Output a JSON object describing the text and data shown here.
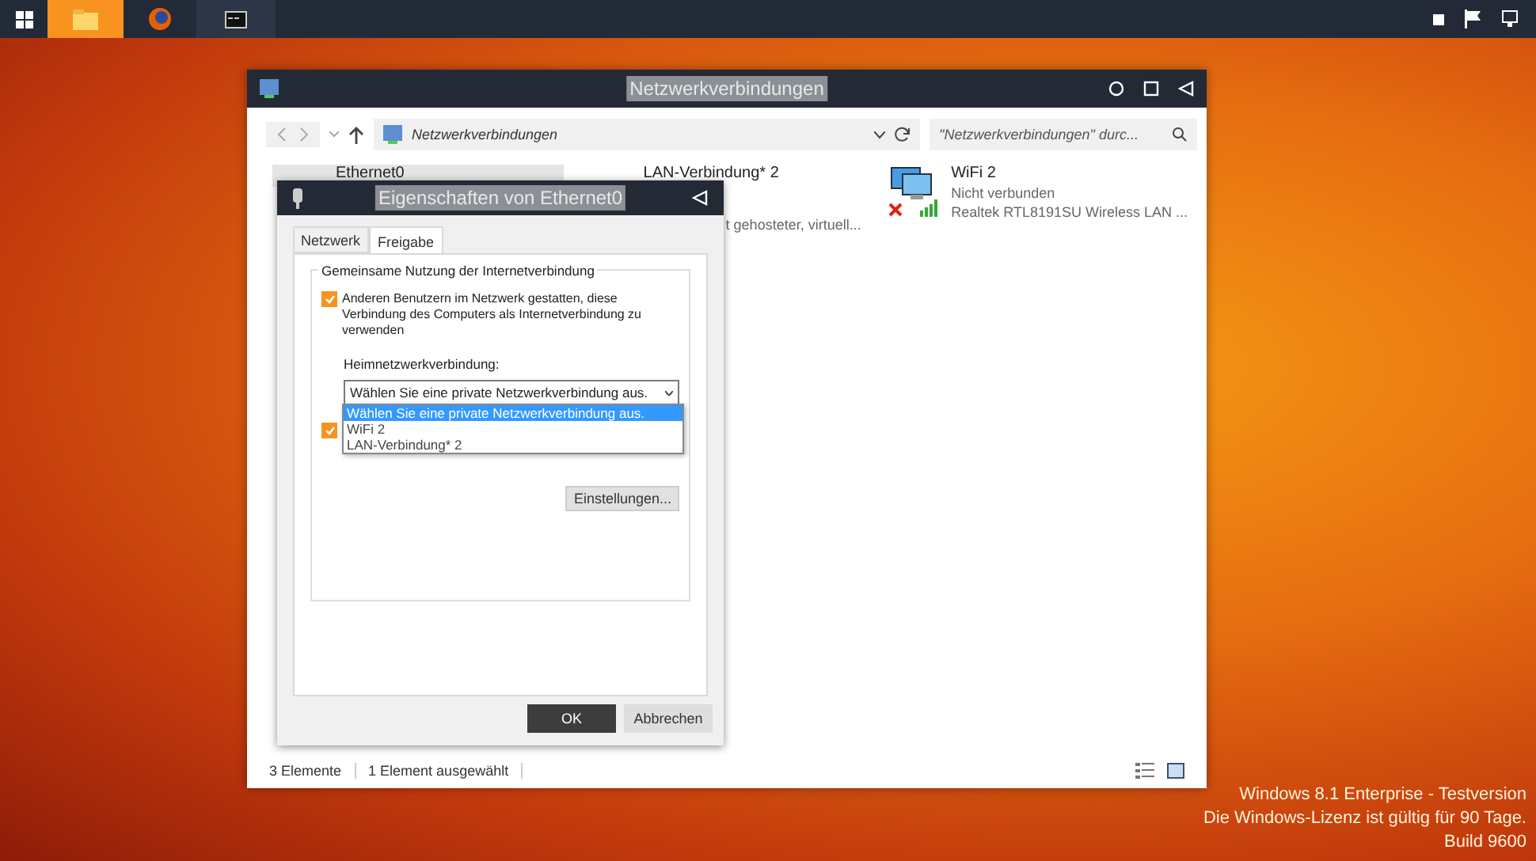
{
  "taskbar": {
    "apps": [
      {
        "kind": "folder",
        "selected": true
      },
      {
        "kind": "browser",
        "selected": false
      },
      {
        "kind": "console",
        "selected": false
      }
    ]
  },
  "explorer": {
    "title": "Netzwerkverbindungen",
    "address": "Netzwerkverbindungen",
    "search": {
      "placeholder": "\"Netzwerkverbindungen\" durc..."
    },
    "items": [
      {
        "name": "Ethernet0",
        "selected": true
      },
      {
        "name": "LAN-Verbindung* 2",
        "selected": false,
        "device": "t gehosteter, virtuell..."
      },
      {
        "name": "WiFi 2",
        "selected": false,
        "status": "Nicht verbunden",
        "device": "Realtek RTL8191SU Wireless LAN ...",
        "connected": false
      }
    ],
    "status_bar": [
      "3 Elemente",
      "1 Element ausgewählt"
    ]
  },
  "dialog": {
    "title": "Eigenschaften von Ethernet0",
    "tabs": [
      {
        "label": "Netzwerk",
        "selected": false
      },
      {
        "label": "Freigabe",
        "selected": true
      }
    ],
    "group_title": "Gemeinsame Nutzung der Internetverbindung",
    "allow_sharing": {
      "label": "Anderen Benutzern im Netzwerk gestatten, diese Verbindung des Computers als Internetverbindung zu verwenden",
      "checked": true
    },
    "home_label": "Heimnetzwerkverbindung:",
    "home_select": {
      "value": "Wählen Sie eine private Netzwerkverbindung aus.",
      "options": [
        {
          "label": "Wählen Sie eine private Netzwerkverbindung aus.",
          "selected": true
        },
        {
          "label": "WiFi 2",
          "selected": false
        },
        {
          "label": "LAN-Verbindung* 2",
          "selected": false
        }
      ]
    },
    "allow_control": {
      "checked": true
    },
    "settings_button": "Einstellungen...",
    "buttons": [
      {
        "label": "OK",
        "kind": "primary"
      },
      {
        "label": "Abbrechen",
        "kind": "secondary"
      }
    ]
  },
  "watermark_lines": [
    "Windows 8.1 Enterprise - Testversion",
    "Die Windows-Lizenz ist gültig für 90 Tage.",
    "Build 9600"
  ]
}
